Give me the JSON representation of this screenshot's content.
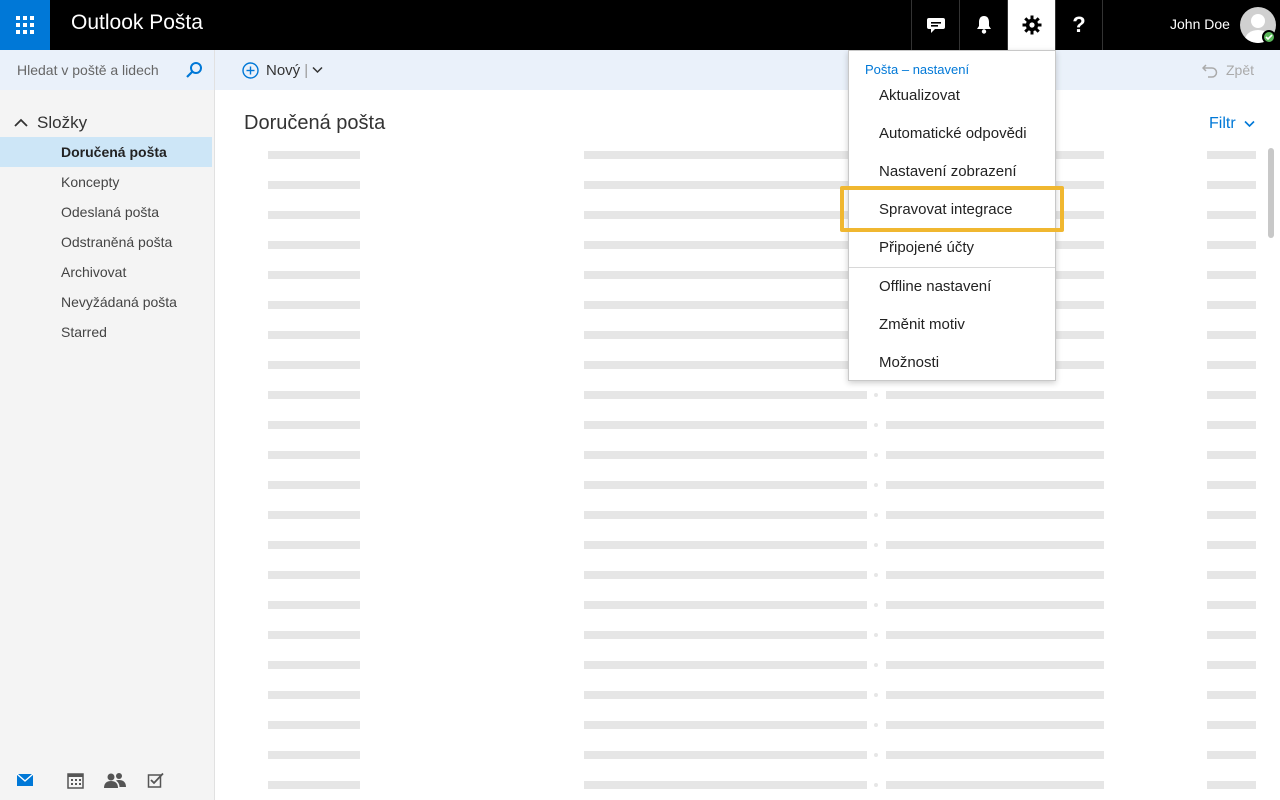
{
  "app": {
    "title": "Outlook Pošta"
  },
  "header": {
    "icons": [
      "chat-icon",
      "bell-icon",
      "gear-icon",
      "help-icon"
    ],
    "help_glyph": "?",
    "user_name": "John Doe"
  },
  "search": {
    "placeholder": "Hledat v poště a lidech"
  },
  "folders": {
    "header": "Složky",
    "items": [
      {
        "label": "Doručená pošta",
        "selected": true
      },
      {
        "label": "Koncepty",
        "selected": false
      },
      {
        "label": "Odeslaná pošta",
        "selected": false
      },
      {
        "label": "Odstraněná pošta",
        "selected": false
      },
      {
        "label": "Archivovat",
        "selected": false
      },
      {
        "label": "Nevyžádaná pošta",
        "selected": false
      },
      {
        "label": "Starred",
        "selected": false
      }
    ]
  },
  "bottom_nav": [
    "mail-icon",
    "calendar-icon",
    "people-icon",
    "tasks-icon"
  ],
  "toolbar": {
    "new_label": "Nový",
    "undo_label": "Zpět"
  },
  "main": {
    "title": "Doručená pošta",
    "filter_label": "Filtr"
  },
  "settings_menu": {
    "header": "Pošta – nastavení",
    "items": [
      "Aktualizovat",
      "Automatické odpovědi",
      "Nastavení zobrazení",
      "Spravovat integrace",
      "Připojené účty",
      "Offline nastavení",
      "Změnit motiv",
      "Možnosti"
    ],
    "highlighted_item": "Spravovat integrace"
  },
  "colors": {
    "accent": "#0078d7",
    "topbar": "#000000",
    "highlight": "#f0b730",
    "selected_folder": "#cde6f7"
  }
}
